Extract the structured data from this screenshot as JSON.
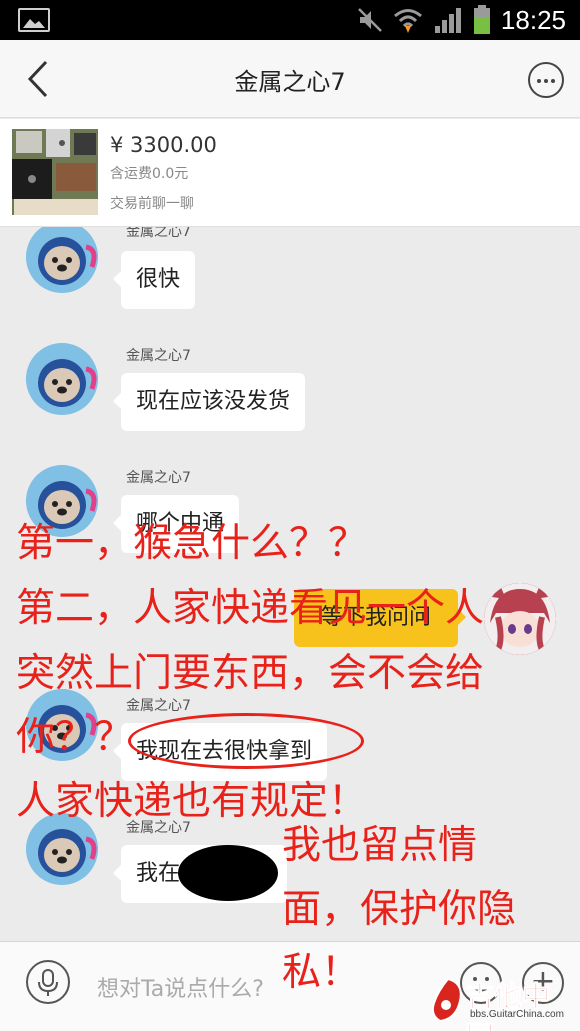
{
  "status_bar": {
    "time": "18:25",
    "icons": [
      "gallery-icon",
      "mute-icon",
      "wifi-icon",
      "signal-icon",
      "battery-icon"
    ]
  },
  "header": {
    "title": "金属之心7",
    "back_icon": "back-arrow-icon",
    "more_icon": "more-icon"
  },
  "product": {
    "price": "¥ 3300.00",
    "shipping": "含运费0.0元",
    "chat_before_trade": "交易前聊一聊"
  },
  "messages": [
    {
      "sender": "金属之心7",
      "text": "很快",
      "from": "other"
    },
    {
      "sender": "金属之心7",
      "text": "现在应该没发货",
      "from": "other"
    },
    {
      "sender": "金属之心7",
      "text": "哪个中通",
      "from": "other"
    },
    {
      "sender": "",
      "text": "等下我问问",
      "from": "self"
    },
    {
      "sender": "金属之心7",
      "text": "我现在去很快拿到",
      "from": "other"
    },
    {
      "sender": "金属之心7",
      "text": "我在",
      "from": "other"
    }
  ],
  "input": {
    "placeholder": "想对Ta说点什么?"
  },
  "annotations": {
    "line1": "第一，猴急什么？？",
    "line2": "第二，人家快递看见一个人",
    "line3": "突然上门要东西，会不会给",
    "line4": "你？？",
    "line5": "人家快递也有规定！",
    "line6": "我也留点情",
    "line7": "面，保护你隐",
    "line8": "私！"
  },
  "watermark": {
    "cn": "吉他中国",
    "en": "bbs.GuitarChina.com"
  },
  "colors": {
    "annotation_red": "#e8221a",
    "self_bubble": "#f7c21b",
    "chat_bg": "#ebebeb"
  }
}
